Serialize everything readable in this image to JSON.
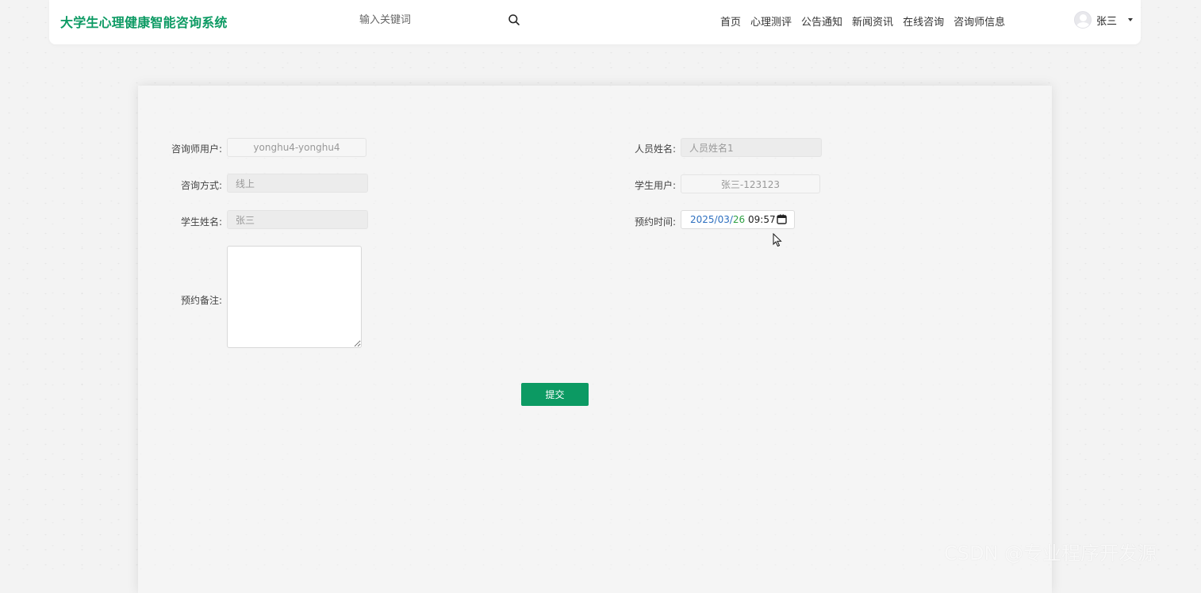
{
  "header": {
    "logo": "大学生心理健康智能咨询系统",
    "search_placeholder": "输入关键词",
    "nav": [
      "首页",
      "心理测评",
      "公告通知",
      "新闻资讯",
      "在线咨询",
      "咨询师信息"
    ],
    "user_name": "张三"
  },
  "form": {
    "counselor_user_label": "咨询师用户:",
    "counselor_user_value": "yonghu4-yonghu4",
    "staff_name_label": "人员姓名:",
    "staff_name_value": "人员姓名1",
    "consult_method_label": "咨询方式:",
    "consult_method_value": "线上",
    "student_user_label": "学生用户:",
    "student_user_value": "张三-123123",
    "student_name_label": "学生姓名:",
    "student_name_value": "张三",
    "appointment_time_label": "预约时间:",
    "appointment_time": {
      "year": "2025",
      "month": "03",
      "day": "26",
      "time": "09:57"
    },
    "remark_label": "预约备注:",
    "remark_value": "",
    "submit_label": "提交"
  },
  "watermark": "CSDN @专业程序开发源",
  "colors": {
    "brand": "#0c9a63"
  }
}
